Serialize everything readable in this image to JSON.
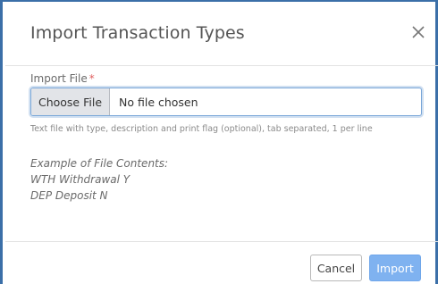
{
  "dialog": {
    "title": "Import Transaction Types",
    "close_icon": "close-icon"
  },
  "form": {
    "label": "Import File",
    "required_mark": "*",
    "choose_button": "Choose File",
    "file_status": "No file chosen",
    "help_text": "Text file with type, description and print flag (optional), tab separated, 1 per line",
    "example_lines": [
      "Example of File Contents:",
      "WTH Withdrawal Y",
      "DEP Deposit N"
    ]
  },
  "footer": {
    "cancel_label": "Cancel",
    "import_label": "Import"
  },
  "colors": {
    "frame": "#3b6fa8",
    "primary": "#7fb2f0",
    "required": "#e06060",
    "focus": "#7aa7d8"
  }
}
